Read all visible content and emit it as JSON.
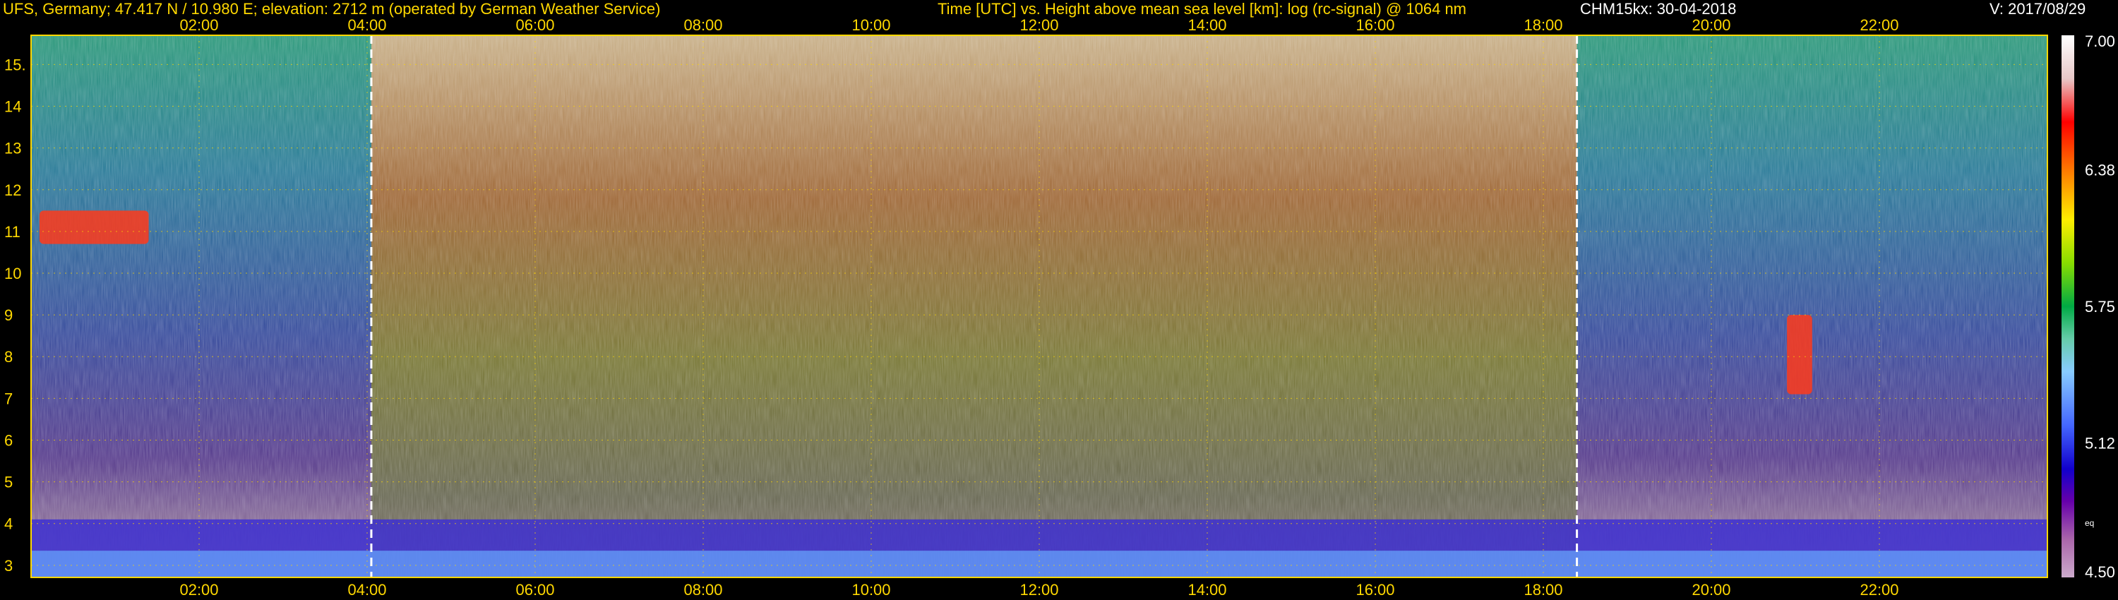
{
  "header": {
    "station": "UFS, Germany; 47.417 N / 10.980 E; elevation: 2712 m  (operated by German Weather Service)",
    "axis_title": "Time [UTC] vs. Height above mean sea level [km]: log (rc-signal) @ 1064 nm",
    "instrument_date": "CHM15kx: 30-04-2018",
    "version": "V: 2017/08/29"
  },
  "chart_data": {
    "type": "heatmap",
    "title": "Time [UTC] vs. Height above mean sea level [km]: log (rc-signal) @ 1064 nm",
    "x_axis": {
      "range_hours": [
        0,
        24
      ],
      "tick_hours": [
        2,
        4,
        6,
        8,
        10,
        12,
        14,
        16,
        18,
        20,
        22
      ],
      "tick_labels": [
        "02:00",
        "04:00",
        "06:00",
        "08:00",
        "10:00",
        "12:00",
        "14:00",
        "16:00",
        "18:00",
        "20:00",
        "22:00"
      ]
    },
    "y_axis": {
      "range_km": [
        2.71,
        15.7
      ],
      "ticks": [
        3,
        4,
        5,
        6,
        7,
        8,
        9,
        10,
        11,
        12,
        13,
        14,
        15
      ],
      "tick_labels": [
        "3",
        "4",
        "5",
        "6",
        "7",
        "8",
        "9",
        "10",
        "11",
        "12",
        "13",
        "14",
        "15."
      ]
    },
    "colorbar": {
      "range": [
        4.5,
        7.0
      ],
      "tick_values": [
        7.0,
        6.38,
        5.75,
        5.12,
        4.5
      ],
      "tick_labels": [
        "7.00",
        "6.38",
        "5.75",
        "5.12",
        "4.50"
      ],
      "unit_label": "eq"
    },
    "daylight_markers_hours": [
      4.05,
      18.4
    ],
    "grid": "on",
    "features": [
      {
        "kind": "cloud",
        "hours": [
          0.1,
          1.4
        ],
        "km": [
          10.7,
          11.5
        ]
      },
      {
        "kind": "cloud",
        "hours": [
          20.9,
          21.2
        ],
        "km": [
          7.1,
          9.0
        ]
      },
      {
        "kind": "aerosol_layer",
        "hours": [
          0,
          24
        ],
        "km": [
          2.71,
          4.1
        ]
      }
    ]
  }
}
